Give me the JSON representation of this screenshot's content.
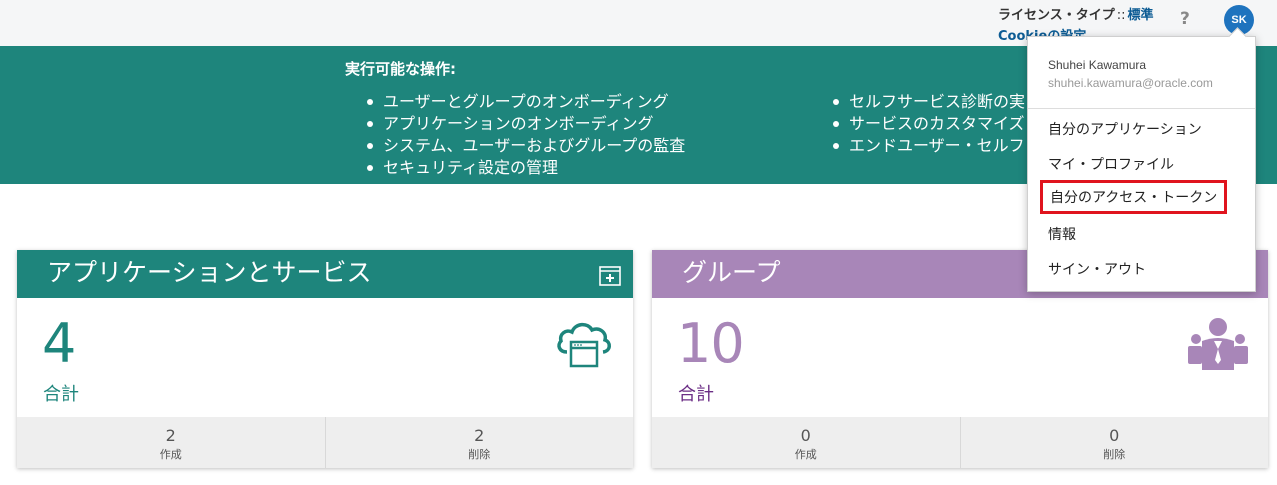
{
  "header": {
    "license_label": "ライセンス・タイプ",
    "license_sep": "::",
    "license_value": "標準",
    "cookie_link": "Cookieの設定",
    "help_icon": "?",
    "avatar_initials": "SK"
  },
  "banner": {
    "title": "実行可能な操作:",
    "left_actions": [
      "ユーザーとグループのオンボーディング",
      "アプリケーションのオンボーディング",
      "システム、ユーザーおよびグループの監査",
      "セキュリティ設定の管理"
    ],
    "right_actions": [
      "セルフサービス診断の実",
      "サービスのカスタマイズ",
      "エンドユーザー・セルフ"
    ]
  },
  "cards": {
    "apps": {
      "title": "アプリケーションとサービス",
      "count": "4",
      "total_label": "合計",
      "created_value": "2",
      "created_label": "作成",
      "deleted_value": "2",
      "deleted_label": "削除",
      "header_icon": "add-window-icon",
      "icon": "cloud-app-icon"
    },
    "groups": {
      "title": "グループ",
      "count": "10",
      "total_label": "合計",
      "created_value": "0",
      "created_label": "作成",
      "deleted_value": "0",
      "deleted_label": "削除",
      "icon": "group-people-icon"
    }
  },
  "user_menu": {
    "name": "Shuhei Kawamura",
    "email": "shuhei.kawamura@oracle.com",
    "items": [
      "自分のアプリケーション",
      "マイ・プロファイル",
      "自分のアクセス・トークン",
      "情報",
      "サイン・アウト"
    ],
    "highlight_color": "#e0141e"
  },
  "colors": {
    "teal": "#1e857c",
    "purple": "#a886b8",
    "link_blue": "#0d5c94",
    "avatar_blue": "#1e73be"
  }
}
